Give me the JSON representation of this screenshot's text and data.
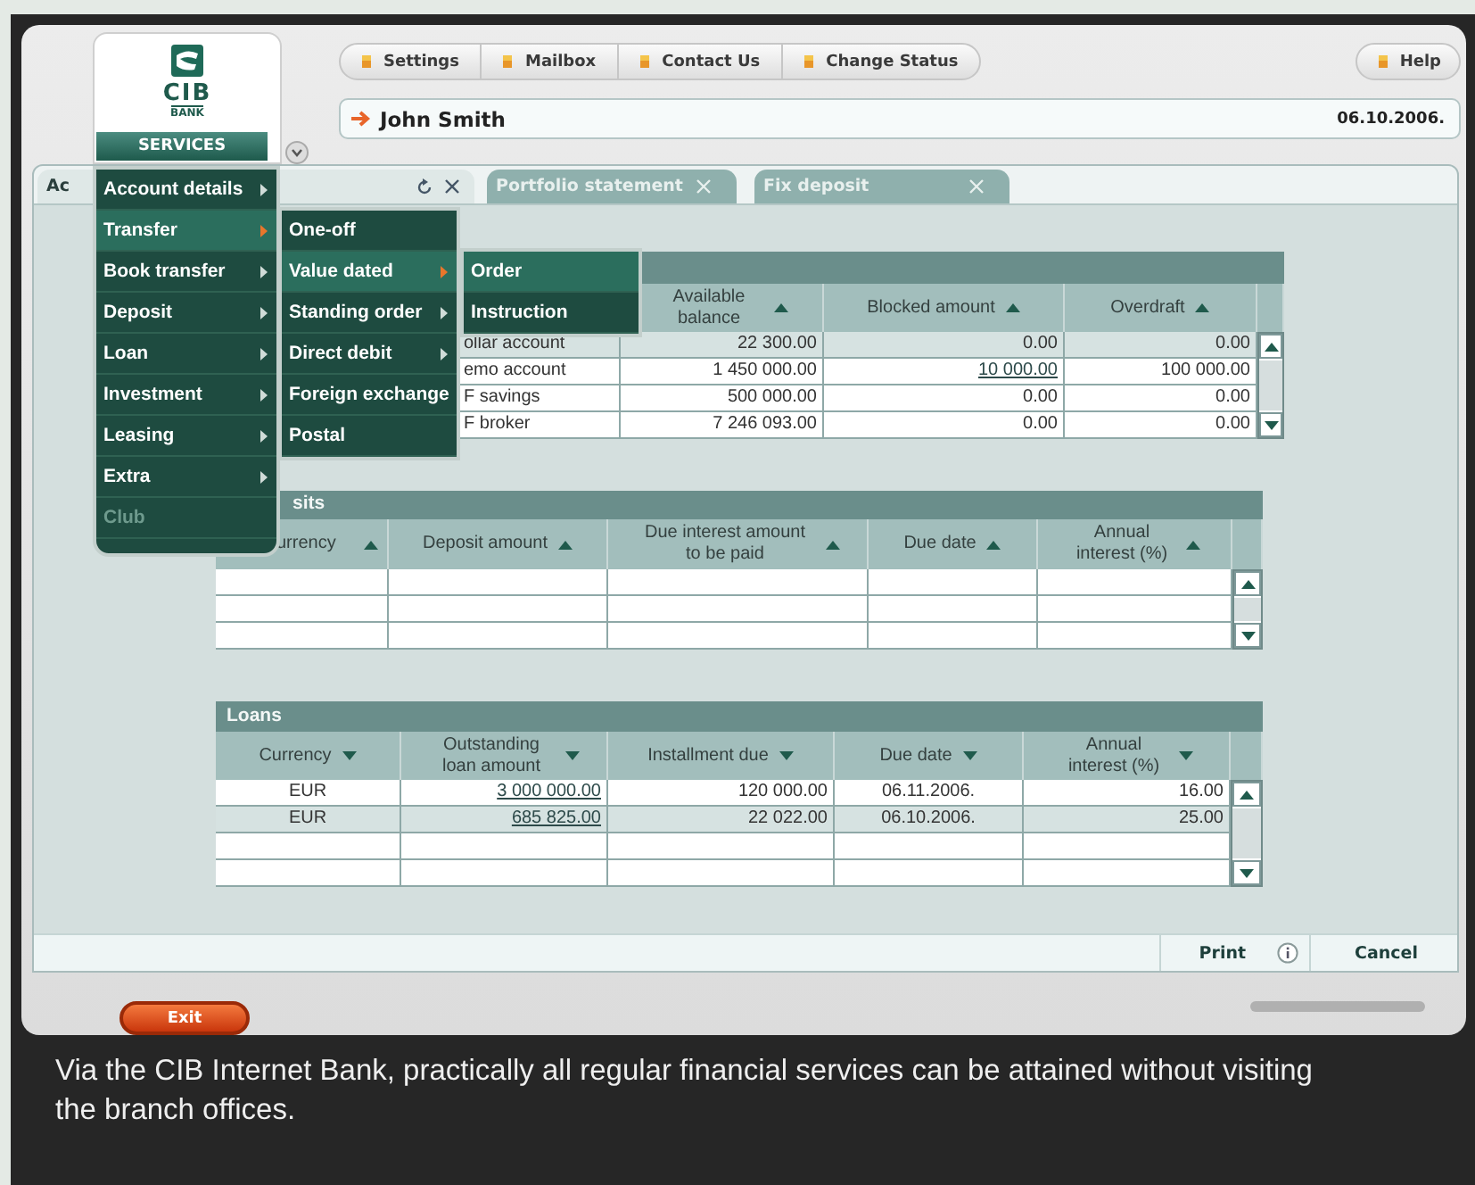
{
  "header": {
    "logo_name": "CIB",
    "logo_sub": "BANK",
    "services": "SERVICES",
    "toolbar": [
      {
        "label": "Settings"
      },
      {
        "label": "Mailbox"
      },
      {
        "label": "Contact Us"
      },
      {
        "label": "Change Status"
      }
    ],
    "help": "Help",
    "user": "John Smith",
    "date": "06.10.2006."
  },
  "tabs": [
    {
      "label": "Ac",
      "selected": true
    },
    {
      "label": "Portfolio statement",
      "selected": false
    },
    {
      "label": "Fix deposit",
      "selected": false
    }
  ],
  "menu": {
    "items": [
      {
        "label": "Account details",
        "selected": false,
        "has_submenu": true,
        "disabled": false
      },
      {
        "label": "Transfer",
        "selected": true,
        "has_submenu": true,
        "disabled": false,
        "children": [
          {
            "label": "One-off",
            "selected": false,
            "has_submenu": false
          },
          {
            "label": "Value dated",
            "selected": true,
            "has_submenu": true,
            "children": [
              {
                "label": "Order",
                "selected": true,
                "has_submenu": false
              },
              {
                "label": "Instruction",
                "selected": false,
                "has_submenu": false
              }
            ]
          },
          {
            "label": "Standing order",
            "selected": false,
            "has_submenu": true
          },
          {
            "label": "Direct debit",
            "selected": false,
            "has_submenu": true
          },
          {
            "label": "Foreign exchange",
            "selected": false,
            "has_submenu": false
          },
          {
            "label": "Postal",
            "selected": false,
            "has_submenu": false
          }
        ]
      },
      {
        "label": "Book transfer",
        "selected": false,
        "has_submenu": true,
        "disabled": false
      },
      {
        "label": "Deposit",
        "selected": false,
        "has_submenu": true,
        "disabled": false
      },
      {
        "label": "Loan",
        "selected": false,
        "has_submenu": true,
        "disabled": false
      },
      {
        "label": "Investment",
        "selected": false,
        "has_submenu": true,
        "disabled": false
      },
      {
        "label": "Leasing",
        "selected": false,
        "has_submenu": true,
        "disabled": false
      },
      {
        "label": "Extra",
        "selected": false,
        "has_submenu": true,
        "disabled": false
      },
      {
        "label": "Club",
        "selected": false,
        "has_submenu": false,
        "disabled": true
      }
    ]
  },
  "tables": [
    {
      "columns": [
        {
          "label": "Available balance",
          "descending": false
        },
        {
          "label": "Blocked amount",
          "descending": false
        },
        {
          "label": "Overdraft",
          "descending": false
        }
      ],
      "rows": [
        {
          "selected": true,
          "cells": [
            {
              "text": "ollar account"
            },
            {
              "text": "22 300.00"
            },
            {
              "text": "0.00"
            },
            {
              "text": "0.00"
            }
          ]
        },
        {
          "selected": false,
          "cells": [
            {
              "text": "emo account"
            },
            {
              "text": "1 450 000.00"
            },
            {
              "text": "10 000.00",
              "link": true
            },
            {
              "text": "100 000.00"
            }
          ]
        },
        {
          "selected": false,
          "cells": [
            {
              "text": "F savings"
            },
            {
              "text": "500 000.00"
            },
            {
              "text": "0.00"
            },
            {
              "text": "0.00"
            }
          ]
        },
        {
          "selected": false,
          "cells": [
            {
              "text": "F broker"
            },
            {
              "text": "7 246 093.00"
            },
            {
              "text": "0.00"
            },
            {
              "text": "0.00"
            }
          ]
        }
      ]
    },
    {
      "title": "sits",
      "columns": [
        {
          "label": "urrency",
          "descending": false
        },
        {
          "label": "Deposit amount",
          "descending": false
        },
        {
          "label": "Due interest amount to be paid",
          "descending": false
        },
        {
          "label": "Due date",
          "descending": false
        },
        {
          "label": "Annual interest (%)",
          "descending": false
        }
      ]
    },
    {
      "title": "Loans",
      "columns": [
        {
          "label": "Currency",
          "descending": true
        },
        {
          "label": "Outstanding loan amount",
          "descending": true
        },
        {
          "label": "Installment due",
          "descending": true
        },
        {
          "label": "Due date",
          "descending": true
        },
        {
          "label": "Annual interest (%)",
          "descending": true
        }
      ],
      "rows": [
        {
          "selected": false,
          "cells": [
            {
              "text": "EUR"
            },
            {
              "text": "3 000 000.00",
              "link": true
            },
            {
              "text": "120 000.00"
            },
            {
              "text": "06.11.2006."
            },
            {
              "text": "16.00"
            }
          ]
        },
        {
          "selected": true,
          "cells": [
            {
              "text": "EUR"
            },
            {
              "text": "685 825.00",
              "link": true
            },
            {
              "text": "22 022.00"
            },
            {
              "text": "06.10.2006."
            },
            {
              "text": "25.00"
            }
          ]
        }
      ]
    }
  ],
  "footer": {
    "print": "Print",
    "cancel": "Cancel"
  },
  "exit": "Exit",
  "caption": "Via the CIB Internet Bank, practically all regular financial services can be attained without visiting the branch offices."
}
